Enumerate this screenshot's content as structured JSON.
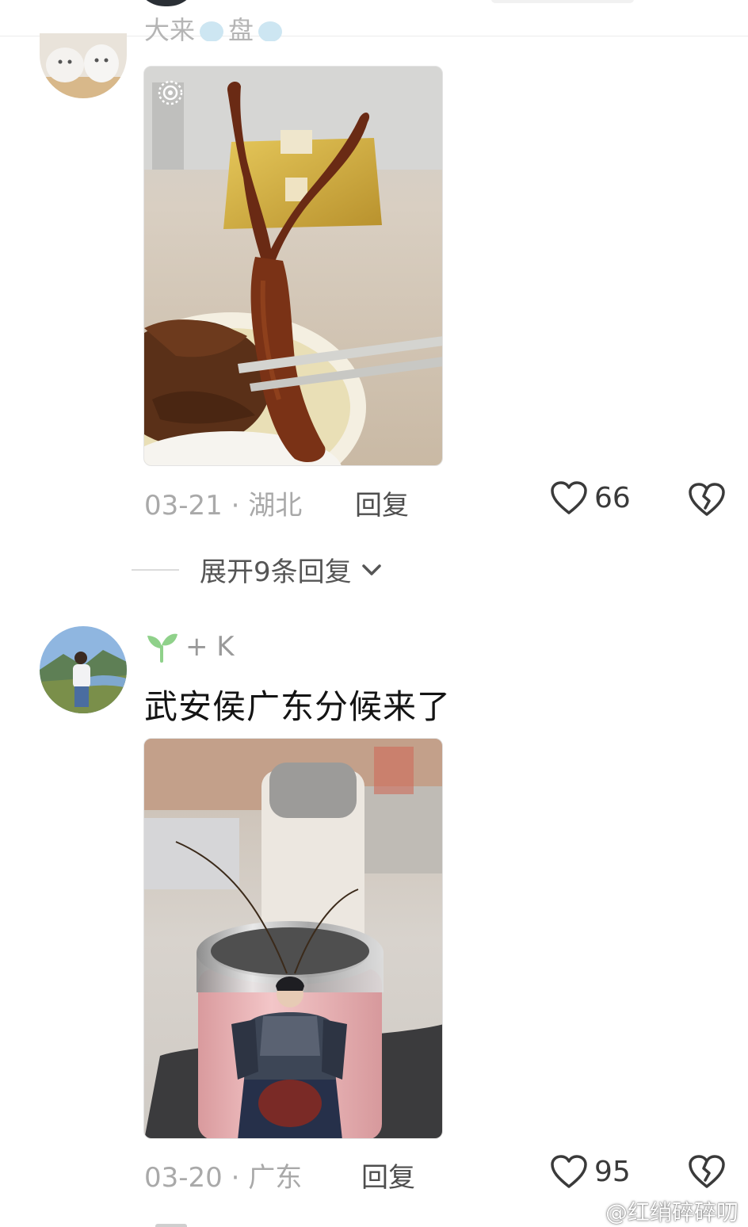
{
  "comment1": {
    "username_partial": "大来",
    "username_partial2": "盘",
    "date": "03-21",
    "location": "湖北",
    "reply_label": "回复",
    "likes": "66"
  },
  "expand": {
    "label": "展开9条回复"
  },
  "comment2": {
    "username": "+ K",
    "text": "武安侯广东分候来了",
    "date": "03-20",
    "location": "广东",
    "reply_label": "回复",
    "likes": "95"
  },
  "watermark": {
    "text": "@红绡碎碎叨"
  },
  "separator": "·",
  "icons": [
    "heart-outline-icon",
    "broken-heart-icon",
    "chevron-down-icon",
    "sprout-icon",
    "live-photo-icon",
    "weibo-logo-icon"
  ]
}
